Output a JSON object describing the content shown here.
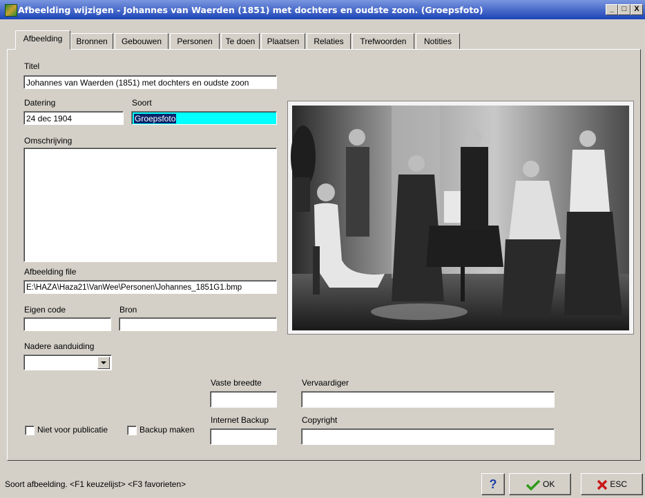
{
  "window": {
    "title": "Afbeelding wijzigen - Johannes van Waerden (1851) met dochters en oudste zoon. (Groepsfoto)",
    "minimize": "_",
    "maximize": "□",
    "close": "X"
  },
  "tabs": [
    {
      "label": "Afbeelding",
      "active": true
    },
    {
      "label": "Bronnen"
    },
    {
      "label": "Gebouwen"
    },
    {
      "label": "Personen"
    },
    {
      "label": "Te doen"
    },
    {
      "label": "Plaatsen"
    },
    {
      "label": "Relaties"
    },
    {
      "label": "Trefwoorden"
    },
    {
      "label": "Notities"
    }
  ],
  "form": {
    "titel_label": "Titel",
    "titel_value": "Johannes van Waerden (1851) met dochters en oudste zoon",
    "datering_label": "Datering",
    "datering_value": "24 dec 1904",
    "soort_label": "Soort",
    "soort_value": "Groepsfoto",
    "omschrijving_label": "Omschrijving",
    "omschrijving_value": "",
    "file_label": "Afbeelding file",
    "file_value": "E:\\HAZA\\Haza21\\VanWee\\Personen\\Johannes_1851G1.bmp",
    "eigen_code_label": "Eigen code",
    "eigen_code_value": "",
    "bron_label": "Bron",
    "bron_value": "",
    "nadere_label": "Nadere aanduiding",
    "nadere_value": "",
    "vaste_breedte_label": "Vaste breedte",
    "vaste_breedte_value": "",
    "vervaardiger_label": "Vervaardiger",
    "vervaardiger_value": "",
    "internet_backup_label": "Internet Backup",
    "internet_backup_value": "",
    "copyright_label": "Copyright",
    "copyright_value": "",
    "niet_voor_publicatie_label": "Niet voor publicatie",
    "niet_voor_publicatie_checked": false,
    "backup_maken_label": "Backup maken",
    "backup_maken_checked": false
  },
  "status": {
    "hint": "Soort afbeelding. <F1 keuzelijst> <F3 favorieten>"
  },
  "buttons": {
    "help_label": "?",
    "ok_label": "OK",
    "esc_label": "ESC"
  },
  "colors": {
    "titlebar": "#1c44b7",
    "selected_field": "#00ffff",
    "ok_check": "#2e9a1a",
    "esc_x": "#c81818",
    "help": "#1a3fa8"
  },
  "icons": {
    "app": "haza-app-icon",
    "ok": "checkmark-icon",
    "esc": "red-x-icon",
    "help": "question-mark-icon",
    "dropdown": "triangle-down-icon"
  }
}
